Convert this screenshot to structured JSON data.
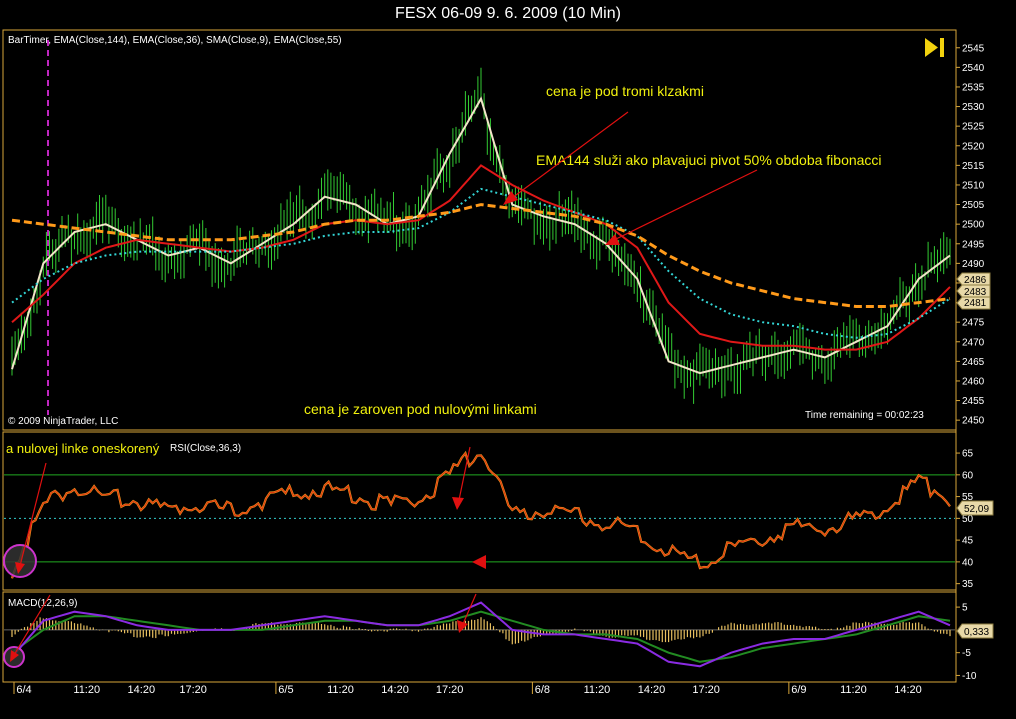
{
  "window": {
    "title": "FESX 06-09  9. 6. 2009 (10 Min)"
  },
  "price_panel": {
    "indicator_legend": "BarTimer, EMA(Close,144), EMA(Close,36), SMA(Close,9), EMA(Close,55)",
    "copyright": "© 2009 NinjaTrader, LLC",
    "time_remaining": "Time remaining = 00:02:23",
    "annotations": {
      "a1": "cena je pod tromi klzakmi",
      "a2": "EMA144 služi ako plavajuci pivot 50% obdoba fibonacci",
      "a3": "cena je zaroven pod nulovými linkami"
    },
    "value_labels": [
      "2486",
      "2483",
      "2481"
    ]
  },
  "rsi_panel": {
    "legend": "RSI(Close,36,3)",
    "overlay_text": "a nulovej linke oneskorený",
    "value_label": "52,09"
  },
  "macd_panel": {
    "legend": "MACD(12,26,9)",
    "value_label": "0,333"
  },
  "colors": {
    "price_bar": "#33cc33",
    "ema144": "#ff9a1a",
    "ema36": "#e01818",
    "sma9": "#f2e6c8",
    "ema55": "#33d6d6",
    "rsi": "#e03a10",
    "macd": "#8a2be2",
    "signal": "#228b22",
    "histogram": "#e8c060",
    "annotation_text": "#f2f20e",
    "arrow": "#e01010",
    "guide_line": "#ff33ff",
    "level_line": "#22aa22",
    "axis_text": "#ffffff"
  },
  "chart_data": [
    {
      "type": "line",
      "title": "FESX 06-09  9. 6. 2009 (10 Min)",
      "ylim": [
        2448,
        2548
      ],
      "yticks": [
        2450,
        2455,
        2460,
        2465,
        2470,
        2475,
        2480,
        2485,
        2490,
        2495,
        2500,
        2505,
        2510,
        2515,
        2520,
        2525,
        2530,
        2535,
        2540,
        2545
      ],
      "x": [
        0,
        10,
        20,
        30,
        40,
        50,
        60,
        70,
        80,
        90,
        100,
        110,
        120,
        130,
        140,
        150,
        160,
        170,
        180,
        190,
        200,
        210,
        220,
        230,
        240,
        250,
        260,
        270,
        280,
        290,
        300
      ],
      "x_tick_labels": [
        {
          "x": 2,
          "label": "6/4"
        },
        {
          "x": 25,
          "label": "11:20"
        },
        {
          "x": 45,
          "label": "14:20"
        },
        {
          "x": 64,
          "label": "17:20"
        },
        {
          "x": 98,
          "label": "6/5"
        },
        {
          "x": 118,
          "label": "11:20"
        },
        {
          "x": 138,
          "label": "14:20"
        },
        {
          "x": 158,
          "label": "17:20"
        },
        {
          "x": 192,
          "label": "6/8"
        },
        {
          "x": 212,
          "label": "11:20"
        },
        {
          "x": 232,
          "label": "14:20"
        },
        {
          "x": 252,
          "label": "17:20"
        },
        {
          "x": 286,
          "label": "6/9"
        },
        {
          "x": 306,
          "label": "11:20"
        },
        {
          "x": 326,
          "label": "14:20"
        }
      ],
      "series": [
        {
          "name": "SMA(Close,9)",
          "values": [
            2463,
            2490,
            2498,
            2500,
            2496,
            2492,
            2494,
            2490,
            2495,
            2500,
            2507,
            2505,
            2500,
            2502,
            2518,
            2532,
            2505,
            2502,
            2500,
            2495,
            2486,
            2465,
            2462,
            2464,
            2466,
            2468,
            2466,
            2470,
            2474,
            2486,
            2492
          ]
        },
        {
          "name": "EMA(Close,36)",
          "values": [
            2475,
            2482,
            2490,
            2494,
            2496,
            2495,
            2494,
            2493,
            2494,
            2496,
            2500,
            2501,
            2500,
            2501,
            2506,
            2515,
            2510,
            2506,
            2503,
            2500,
            2494,
            2480,
            2472,
            2470,
            2469,
            2469,
            2468,
            2468,
            2470,
            2476,
            2484
          ]
        },
        {
          "name": "EMA(Close,55)",
          "values": [
            2480,
            2486,
            2490,
            2492,
            2493,
            2493,
            2493,
            2493,
            2494,
            2495,
            2497,
            2498,
            2498,
            2499,
            2503,
            2509,
            2507,
            2505,
            2503,
            2501,
            2497,
            2488,
            2481,
            2477,
            2475,
            2474,
            2472,
            2471,
            2472,
            2476,
            2481
          ]
        },
        {
          "name": "EMA(Close,144)",
          "values": [
            2501,
            2500,
            2499,
            2498,
            2497,
            2496,
            2496,
            2496,
            2497,
            2498,
            2500,
            2501,
            2501,
            2502,
            2503,
            2505,
            2504,
            2503,
            2502,
            2500,
            2497,
            2492,
            2488,
            2485,
            2483,
            2481,
            2480,
            2479,
            2479,
            2480,
            2481
          ]
        }
      ]
    },
    {
      "type": "line",
      "ylim": [
        34,
        68
      ],
      "yticks": [
        35,
        40,
        45,
        50,
        55,
        60,
        65
      ],
      "levels": [
        40,
        60
      ],
      "mid_level": 50,
      "x": [
        0,
        10,
        20,
        30,
        40,
        50,
        60,
        70,
        80,
        90,
        100,
        110,
        120,
        130,
        140,
        150,
        160,
        170,
        180,
        190,
        200,
        210,
        220,
        230,
        240,
        250,
        260,
        270,
        280,
        290,
        300
      ],
      "series": [
        {
          "name": "RSI(Close,36,3)",
          "values": [
            38,
            53,
            57,
            55,
            54,
            52,
            53,
            52,
            54,
            56,
            57,
            55,
            53,
            54,
            60,
            66,
            51,
            52,
            51,
            49,
            47,
            42,
            40,
            43,
            45,
            48,
            47,
            50,
            52,
            59,
            54
          ]
        }
      ]
    },
    {
      "type": "line",
      "title": "MACD(12,26,9)",
      "ylim": [
        -11,
        7
      ],
      "yticks": [
        5,
        -5,
        -10
      ],
      "x": [
        0,
        10,
        20,
        30,
        40,
        50,
        60,
        70,
        80,
        90,
        100,
        110,
        120,
        130,
        140,
        150,
        160,
        170,
        180,
        190,
        200,
        210,
        220,
        230,
        240,
        250,
        260,
        270,
        280,
        290,
        300
      ],
      "series": [
        {
          "name": "MACD",
          "values": [
            -6,
            2,
            4,
            3,
            1,
            0,
            0,
            0,
            1,
            2,
            3,
            2,
            1,
            1,
            3,
            6,
            0,
            -1,
            -1,
            -2,
            -3,
            -7,
            -8,
            -5,
            -3,
            -2,
            -2,
            0,
            2,
            4,
            1
          ]
        },
        {
          "name": "Signal",
          "values": [
            -5,
            0,
            3,
            3,
            2,
            1,
            0,
            0,
            0,
            1,
            2,
            2,
            1,
            1,
            2,
            4,
            2,
            0,
            -1,
            -1,
            -2,
            -5,
            -7,
            -6,
            -4,
            -3,
            -2,
            -1,
            1,
            3,
            2
          ]
        }
      ]
    }
  ]
}
